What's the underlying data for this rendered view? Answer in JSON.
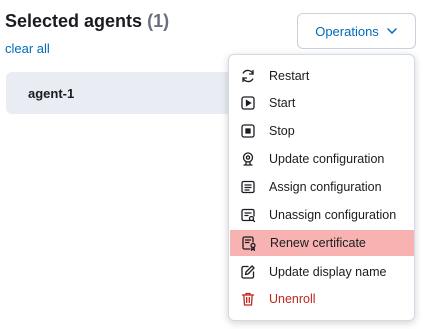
{
  "header": {
    "title": "Selected agents",
    "count": "(1)",
    "clear_all": "clear all"
  },
  "agents": [
    {
      "name": "agent-1"
    }
  ],
  "operations_button": {
    "label": "Operations",
    "icon": "chevron-down-icon"
  },
  "menu": {
    "items": [
      {
        "label": "Restart",
        "icon": "refresh-icon"
      },
      {
        "label": "Start",
        "icon": "play-icon"
      },
      {
        "label": "Stop",
        "icon": "stop-icon"
      },
      {
        "label": "Update configuration",
        "icon": "update-config-icon"
      },
      {
        "label": "Assign configuration",
        "icon": "assign-config-icon"
      },
      {
        "label": "Unassign configuration",
        "icon": "unassign-config-icon"
      },
      {
        "label": "Renew certificate",
        "icon": "certificate-icon",
        "highlighted": true
      },
      {
        "label": "Update display name",
        "icon": "edit-icon"
      },
      {
        "label": "Unenroll",
        "icon": "trash-icon",
        "danger": true
      }
    ]
  },
  "colors": {
    "accent": "#006bb8",
    "danger": "#bd271e",
    "highlight": "#f8b2b2",
    "row_background": "#e9edf3"
  }
}
